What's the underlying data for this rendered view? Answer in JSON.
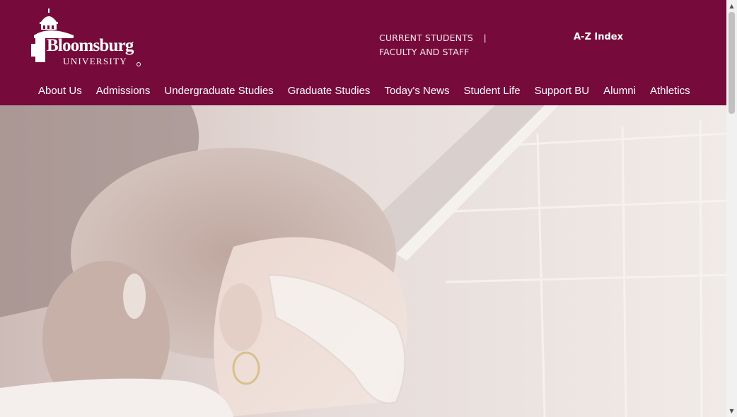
{
  "header": {
    "brand_color": "#760a3a",
    "logo": {
      "wordmark": "Bloomsburg",
      "subline": "UNIVERSITY",
      "icon": "dome-icon"
    },
    "utility_links": [
      "CURRENT STUDENTS",
      "FACULTY AND STAFF"
    ],
    "utility_separator": "|",
    "az_index": "A-Z Index"
  },
  "main_nav": {
    "items": [
      "About Us",
      "Admissions",
      "Undergraduate Studies",
      "Graduate Studies",
      "Today's News",
      "Student Life",
      "Support BU",
      "Alumni",
      "Athletics"
    ]
  },
  "hero": {
    "image": "student-in-lab-wearing-safety-goggles"
  },
  "scrollbar": {
    "up_arrow": "▲",
    "down_arrow": "▼"
  }
}
